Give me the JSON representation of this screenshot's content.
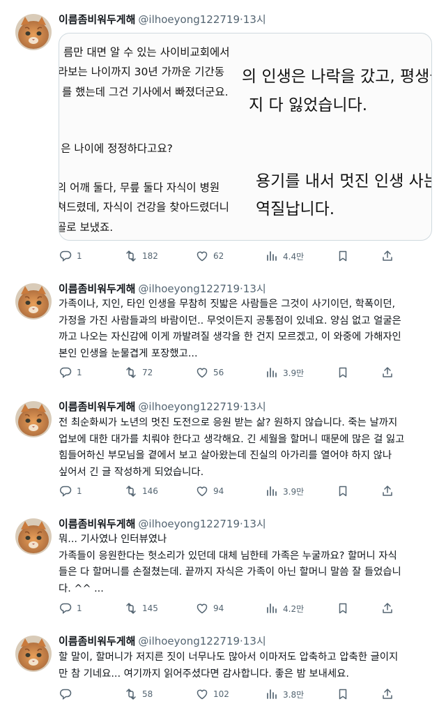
{
  "user": {
    "name": "이름좀비워두게해",
    "handle": "@ilhoeyong122719",
    "time": "13시",
    "separator": "·"
  },
  "media_lines_left": [
    "름만 대면 알 수 있는 사이비교회에서",
    "라보는 나이까지 30년 가까운 기간동",
    "를 했는데 그건 기사에서 빠졌더군요.",
    "",
    "!은 나이에 정정하다고요?",
    "",
    "의 어깨 둘다, 무릎 둘다 자식이 병원",
    "쳐드렸데, 자식이 건강을 찾아드렸더니",
    "골로 보냈죠."
  ],
  "media_lines_right": [
    "의 인생은 나락을 갔고, 평생을",
    "지 다 잃었습니다.",
    "용기를 내서 멋진 인생 사는",
    "역질납니다."
  ],
  "tweets": [
    {
      "lines": [],
      "replies": "1",
      "retweets": "182",
      "likes": "62",
      "views": "4.4만"
    },
    {
      "lines": [
        "가족이나, 지인, 타인 인생을 무참히 짓밟은 사람들은 그것이 사기이던, 학폭이던,",
        "가정을 가진 사람들과의 바람이던.. 무엇이든지 공통점이 있네요. 양심 없고 얼굴은",
        "까고 나오는 자신감에 이게 까발려질 생각을 한 건지 모르겠고, 이 와중에 가해자인",
        "본인 인생을 눈물겹게 포장했고..."
      ],
      "replies": "1",
      "retweets": "72",
      "likes": "56",
      "views": "3.9만"
    },
    {
      "lines": [
        "전 최순화씨가 노년의 멋진 도전으로 응원 받는 삶? 원하지 않습니다. 죽는 날까지",
        "업보에 대한 대가를 치뤄야 한다고 생각해요. 긴 세월을 할머니 때문에 많은 걸 잃고",
        "힘들어하신 부모님을 곁에서 보고 살아왔는데 진실의 아가리를 열어야 하지 않나",
        "싶어서 긴 글 작성하게 되었습니다."
      ],
      "replies": "1",
      "retweets": "146",
      "likes": "94",
      "views": "3.9만"
    },
    {
      "lines": [
        "뭐... 기사였나 인터뷰였나",
        "가족들이 응원한다는 헛소리가 있던데 대체 님한테 가족은 누굴까요? 할머니 자식",
        "들은 다 할머니를 손절쳤는데. 끝까지 자식은 가족이 아닌 할머니 말씀 잘 들었습니",
        "다. ^^ ..."
      ],
      "replies": "1",
      "retweets": "145",
      "likes": "94",
      "views": "4.2만"
    },
    {
      "lines": [
        "할 말이, 할머니가 저지른 짓이 너무나도 많아서 이마저도 압축하고 압축한 글이지",
        "만 참 기네요... 여기까지 읽어주셨다면 감사합니다. 좋은 밤 보내세요."
      ],
      "replies": "",
      "retweets": "58",
      "likes": "102",
      "views": "3.8만"
    }
  ],
  "icons": [
    "reply-icon",
    "retweet-icon",
    "like-icon",
    "views-icon",
    "bookmark-icon",
    "share-icon"
  ],
  "colors": {
    "text": "#0f1419",
    "muted": "#536471",
    "border": "#cfd9de"
  }
}
